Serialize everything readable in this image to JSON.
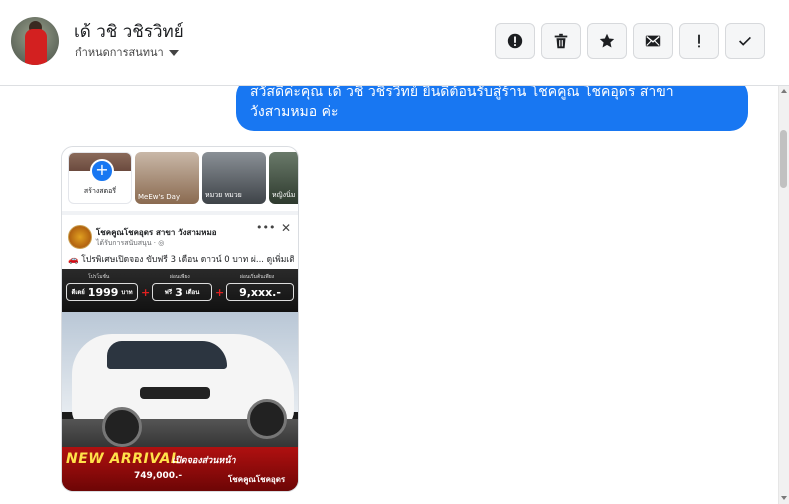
{
  "header": {
    "contact_name": "เด้ วชิ วชิรวิทย์",
    "conversation_label": "กำหนดการสนทนา",
    "actions": [
      {
        "name": "report-button",
        "icon": "exclamation-circle-icon"
      },
      {
        "name": "delete-button",
        "icon": "trash-icon"
      },
      {
        "name": "star-button",
        "icon": "star-icon"
      },
      {
        "name": "mark-unread-button",
        "icon": "envelope-icon"
      },
      {
        "name": "follow-up-button",
        "icon": "exclamation-icon"
      },
      {
        "name": "mark-done-button",
        "icon": "check-icon"
      }
    ]
  },
  "messages": [
    {
      "direction": "outgoing",
      "text": "สวัสดีค่ะคุณ เด้ วชิ วชิรวิทย์ ยินดีต้อนรับสู่ร้าน โชคคูณ โชคอุดร สาขา วังสามหมอ ค่ะ"
    }
  ],
  "attachment": {
    "stories": {
      "create_label": "สร้างสตอรี่",
      "items": [
        {
          "label": "MeEw's Day"
        },
        {
          "label": "หมวย หมวย"
        },
        {
          "label": "หญิงนิ่ม ค"
        }
      ]
    },
    "post": {
      "page_name": "โชคคูณโชคอุดร สาขา วังสามหมอ",
      "sponsored": "ได้รับการสนับสนุน · ◎",
      "text": "🚗 โปรพิเศษเปิดจอง ขับฟรี 3 เดือน ดาวน์ 0 บาท ผ่... ดูเพิ่มเติม",
      "ad": {
        "box1_caption": "โปรโมชั่น",
        "box1_value": "1999",
        "box1_prefix": "ดีเดย์",
        "box1_unit": "บาท",
        "box2_caption": "ผ่อนเพียง",
        "box2_prefix": "ฟรี",
        "box2_value": "3",
        "box2_unit": "เดือน",
        "box3_caption": "ผ่อนเริ่มต้นเพียง",
        "box3_value": "9,xxx.-",
        "headline": "NEW ARRIVAL",
        "subhead": "เปิดจองส่วนหน้า",
        "price": "749,000.-",
        "brand_text": "โชคคูณโชคอุดร"
      }
    }
  },
  "colors": {
    "accent": "#1877f2",
    "bubble_text": "#ffffff",
    "arrival_yellow": "#ffe14a"
  }
}
